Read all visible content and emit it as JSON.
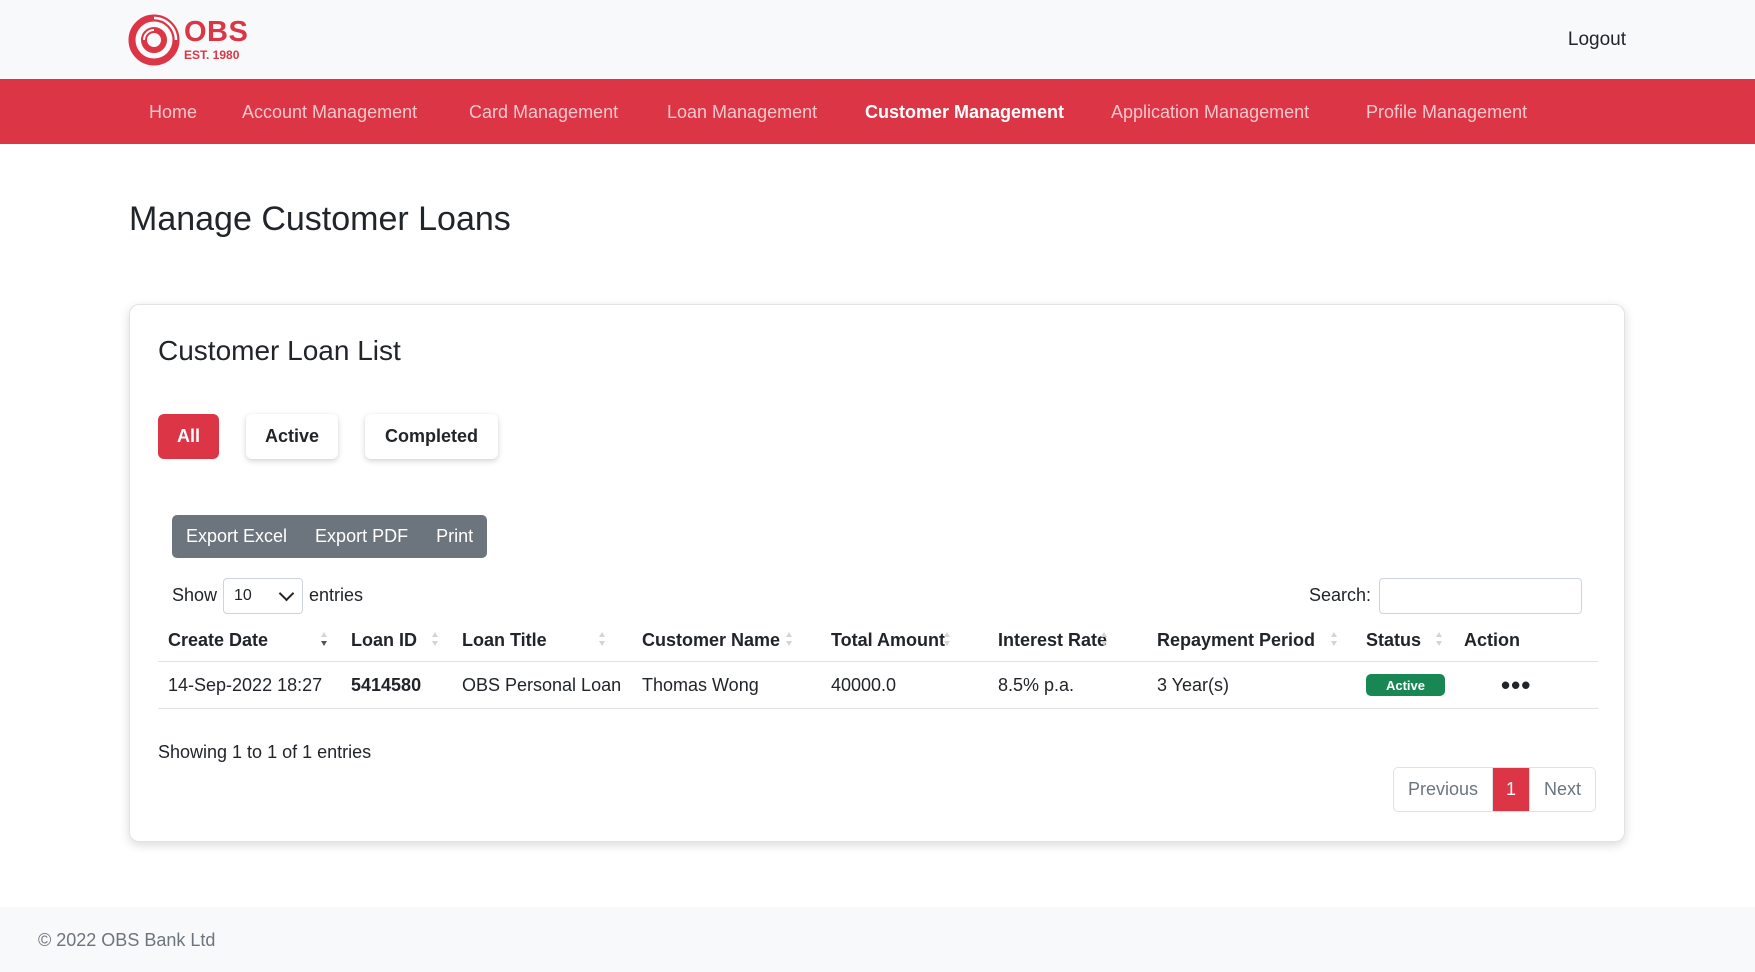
{
  "brand": {
    "name": "OBS",
    "est": "EST. 1980"
  },
  "header": {
    "logout_label": "Logout"
  },
  "nav": {
    "items": [
      {
        "label": "Home"
      },
      {
        "label": "Account Management"
      },
      {
        "label": "Card Management"
      },
      {
        "label": "Loan Management"
      },
      {
        "label": "Customer Management",
        "active": true
      },
      {
        "label": "Application Management"
      },
      {
        "label": "Profile Management"
      }
    ]
  },
  "page": {
    "title": "Manage Customer Loans"
  },
  "card": {
    "title": "Customer Loan List",
    "filters": {
      "all": "All",
      "active": "Active",
      "completed": "Completed",
      "selected": "All"
    },
    "export": {
      "excel": "Export Excel",
      "pdf": "Export PDF",
      "print": "Print"
    },
    "length": {
      "show": "Show",
      "value": "10",
      "entries": "entries"
    },
    "search": {
      "label": "Search:",
      "value": ""
    },
    "table": {
      "columns": [
        "Create Date",
        "Loan ID",
        "Loan Title",
        "Customer Name",
        "Total Amount",
        "Interest Rate",
        "Repayment Period",
        "Status",
        "Action"
      ],
      "rows": [
        {
          "create_date": "14-Sep-2022 18:27",
          "loan_id": "5414580",
          "loan_title": "OBS Personal Loan",
          "customer_name": "Thomas Wong",
          "total_amount": "40000.0",
          "interest_rate": "8.5% p.a.",
          "repayment_period": "3 Year(s)",
          "status": "Active",
          "action": "•••"
        }
      ]
    },
    "info": "Showing 1 to 1 of 1 entries",
    "pagination": {
      "previous": "Previous",
      "current": "1",
      "next": "Next"
    }
  },
  "footer": {
    "text": "© 2022 OBS Bank Ltd"
  },
  "colors": {
    "brand_red": "#dc3545",
    "status_active": "#198754",
    "export_gray": "#6c757d"
  }
}
